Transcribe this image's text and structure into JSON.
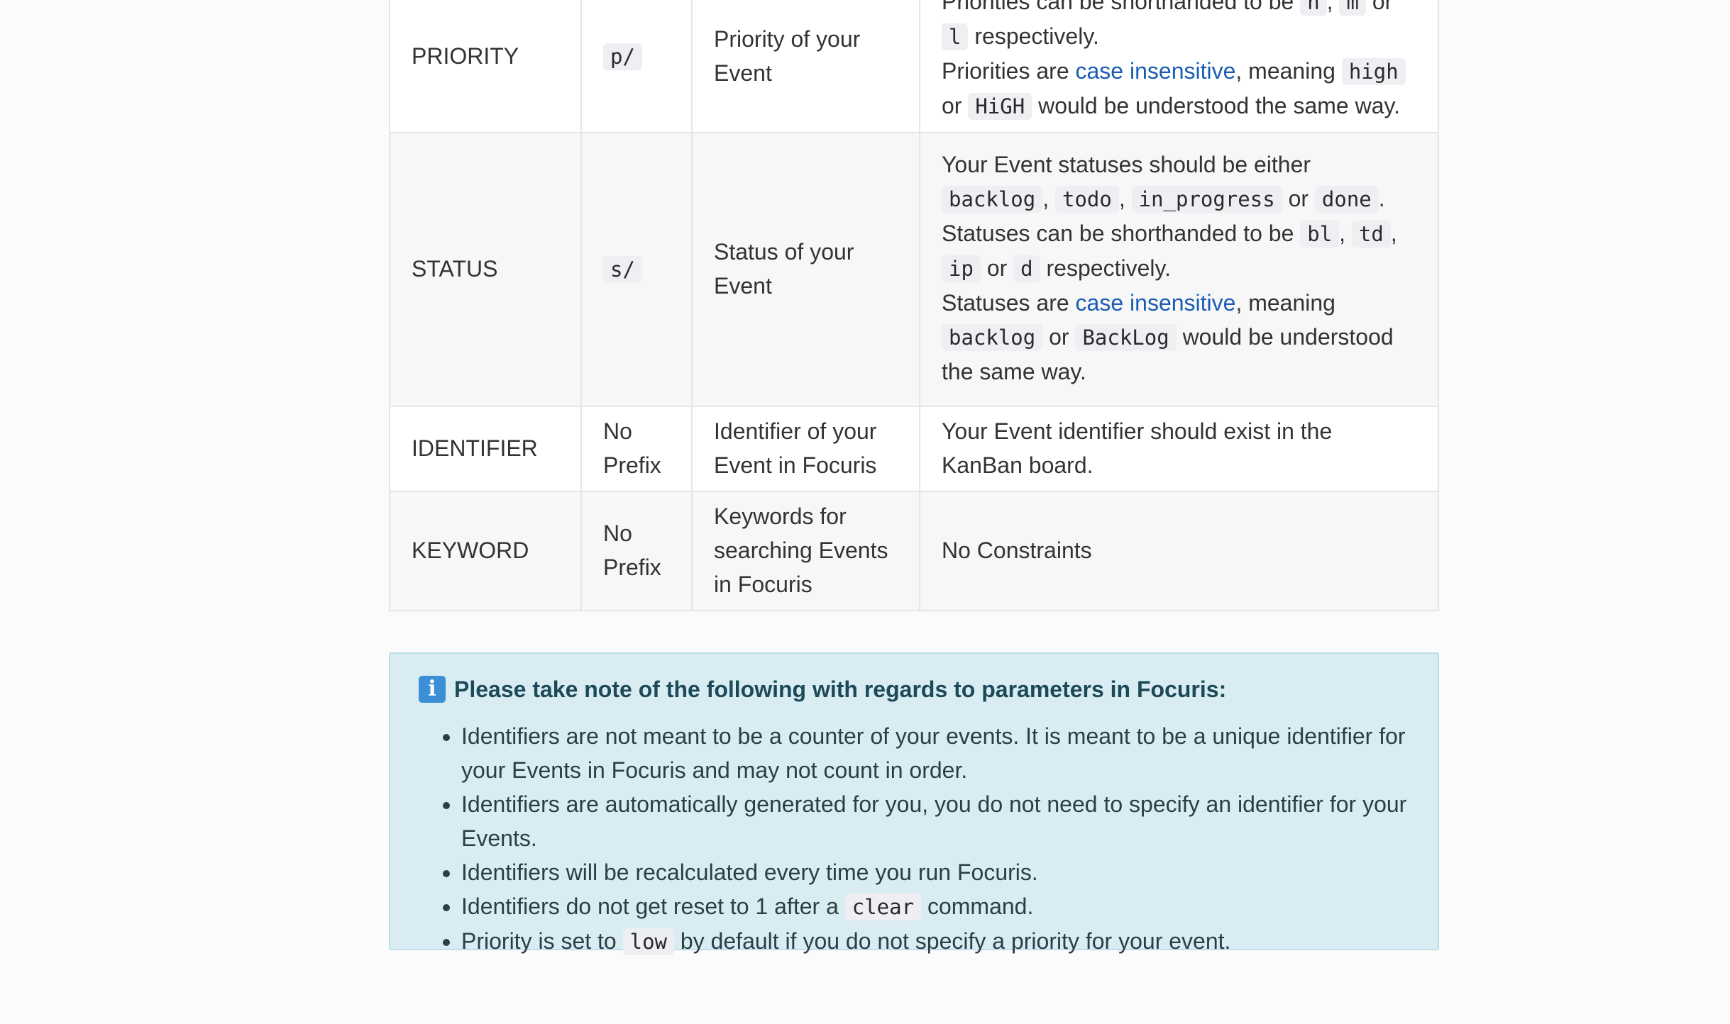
{
  "table": {
    "rows": [
      {
        "name": "PRIORITY",
        "prefix": "p/",
        "meaning": "Priority of your Event",
        "constraints": {
          "line1": {
            "pre": "Priorities can be shorthanded to be ",
            "c1": "h",
            "s1": ", ",
            "c2": "m",
            "s2": " or ",
            "c3": "l",
            "post": " respectively."
          },
          "line2": {
            "pre": "Priorities are ",
            "link": "case insensitive",
            "mid": ", meaning ",
            "c1": "high",
            "s1": " or ",
            "c2": "HiGH",
            "post": " would be understood the same way."
          }
        }
      },
      {
        "name": "STATUS",
        "prefix": "s/",
        "meaning": "Status of your Event",
        "constraints": {
          "line0": {
            "pre": "Your Event statuses should be either ",
            "c1": "backlog",
            "s1": ", ",
            "c2": "todo",
            "s2": ", ",
            "c3": "in_progress",
            "s3": " or ",
            "c4": "done",
            "post": "."
          },
          "line1": {
            "pre": "Statuses can be shorthanded to be ",
            "c1": "bl",
            "s1": ", ",
            "c2": "td",
            "s2": ", ",
            "c3": "ip",
            "s3": " or ",
            "c4": "d",
            "post": " respectively."
          },
          "line2": {
            "pre": "Statuses are ",
            "link": "case insensitive",
            "mid": ", meaning ",
            "c1": "backlog",
            "s1": " or ",
            "c2": "BackLog",
            "post": " would be understood the same way."
          }
        }
      },
      {
        "name": "IDENTIFIER",
        "prefix": "No Prefix",
        "meaning": "Identifier of your Event in Focuris",
        "constraints": "Your Event identifier should exist in the KanBan board."
      },
      {
        "name": "KEYWORD",
        "prefix": "No Prefix",
        "meaning": "Keywords for searching Events in Focuris",
        "constraints": "No Constraints"
      }
    ]
  },
  "note": {
    "icon": "info-icon",
    "icon_glyph": "i",
    "title": "Please take note of the following with regards to parameters in Focuris:",
    "items": [
      {
        "text": "Identifiers are not meant to be a counter of your events. It is meant to be a unique identifier for your Events in Focuris and may not count in order."
      },
      {
        "text": "Identifiers are automatically generated for you, you do not need to specify an identifier for your Events."
      },
      {
        "text": "Identifiers will be recalculated every time you run Focuris."
      },
      {
        "pre": "Identifiers do not get reset to 1 after a ",
        "code": "clear",
        "post": " command."
      },
      {
        "pre": "Priority is set to ",
        "code": "low",
        "post": " by default if you do not specify a priority for your event."
      }
    ]
  },
  "colors": {
    "link": "#1a5cb4",
    "note_background": "#d9ecf2",
    "note_border": "#bcdfe9",
    "info_icon": "#3b8fd6"
  }
}
